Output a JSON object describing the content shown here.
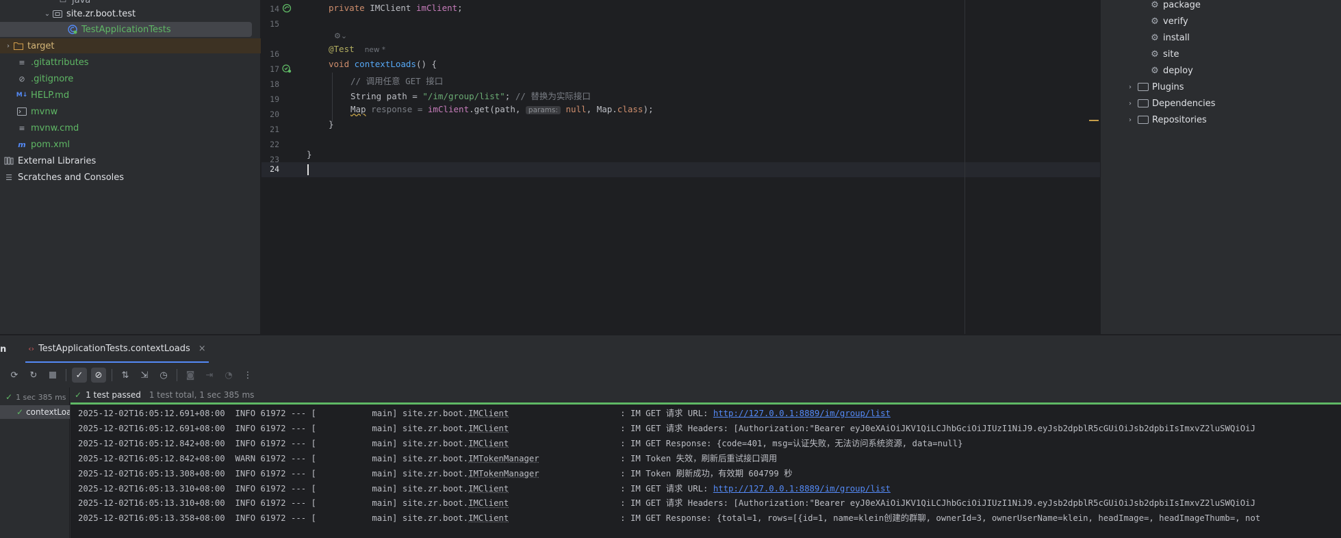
{
  "project_tree": {
    "items": [
      {
        "label": "java",
        "indent": 4
      },
      {
        "label": "site.zr.boot.test"
      },
      {
        "label": "TestApplicationTests"
      },
      {
        "label": "target"
      },
      {
        "label": ".gitattributes"
      },
      {
        "label": ".gitignore"
      },
      {
        "label": "HELP.md"
      },
      {
        "label": "mvnw"
      },
      {
        "label": "mvnw.cmd"
      },
      {
        "label": "pom.xml"
      },
      {
        "label": "External Libraries"
      },
      {
        "label": "Scratches and Consoles"
      }
    ]
  },
  "editor": {
    "line_numbers": [
      "14",
      "15",
      "16",
      "17",
      "18",
      "19",
      "20",
      "21",
      "22",
      "23",
      "24"
    ],
    "code": {
      "l14_kw": "private ",
      "l14_type": "IMClient ",
      "l14_field": "imClient",
      "l14_end": ";",
      "l16_ann": "@Test",
      "l16_hint": "new *",
      "l17_kw": "void ",
      "l17_fn": "contextLoads",
      "l17_end": "() {",
      "l18_cmt": "// 调用任意 GET 接口",
      "l19_type": "String path = ",
      "l19_str": "\"/im/group/list\"",
      "l19_semi": "; ",
      "l19_cmt": "// 替换为实际接口",
      "l20_type": "Map",
      "l20_var": " response = ",
      "l20_field": "imClient",
      "l20_call": ".get(path, ",
      "l20_hint": "params:",
      "l20_null": " null",
      "l20_rest": ", Map.",
      "l20_class": "class",
      "l20_end": ");",
      "l21": "}",
      "l23": "}"
    }
  },
  "maven": {
    "lifecycle": [
      "package",
      "verify",
      "install",
      "site",
      "deploy"
    ],
    "groups": [
      "Plugins",
      "Dependencies",
      "Repositories"
    ]
  },
  "run": {
    "panel_label": "n",
    "tab_label": "TestApplicationTests.contextLoads",
    "tree_time": "1 sec 385 ms",
    "tree_item": "contextLoa",
    "status_passed": "1 test passed",
    "status_detail": "1 test total, 1 sec 385 ms",
    "logs": [
      {
        "ts": "2025-12-02T16:05:12.691+08:00",
        "level": "INFO",
        "pid": "61972",
        "thread": "main",
        "logger_pkg": "site.zr.boot.",
        "logger_cls": "IMClient",
        "msg": ": IM GET 请求 URL: ",
        "link": "http://127.0.0.1:8889/im/group/list",
        "tail": ""
      },
      {
        "ts": "2025-12-02T16:05:12.691+08:00",
        "level": "INFO",
        "pid": "61972",
        "thread": "main",
        "logger_pkg": "site.zr.boot.",
        "logger_cls": "IMClient",
        "msg": ": IM GET 请求 Headers: [Authorization:\"Bearer eyJ0eXAiOiJKV1QiLCJhbGciOiJIUzI1NiJ9.eyJsb2dpblR5cGUiOiJsb2dpbiIsImxvZ2luSWQiOiJ",
        "link": "",
        "tail": ""
      },
      {
        "ts": "2025-12-02T16:05:12.842+08:00",
        "level": "INFO",
        "pid": "61972",
        "thread": "main",
        "logger_pkg": "site.zr.boot.",
        "logger_cls": "IMClient",
        "msg": ": IM GET Response: {code=401, msg=认证失败，无法访问系统资源, data=null}",
        "link": "",
        "tail": ""
      },
      {
        "ts": "2025-12-02T16:05:12.842+08:00",
        "level": "WARN",
        "pid": "61972",
        "thread": "main",
        "logger_pkg": "site.zr.boot.",
        "logger_cls": "IMTokenManager",
        "msg": ": IM Token 失效，刷新后重试接口调用",
        "link": "",
        "tail": ""
      },
      {
        "ts": "2025-12-02T16:05:13.308+08:00",
        "level": "INFO",
        "pid": "61972",
        "thread": "main",
        "logger_pkg": "site.zr.boot.",
        "logger_cls": "IMTokenManager",
        "msg": ": IM Token 刷新成功，有效期 604799 秒",
        "link": "",
        "tail": ""
      },
      {
        "ts": "2025-12-02T16:05:13.310+08:00",
        "level": "INFO",
        "pid": "61972",
        "thread": "main",
        "logger_pkg": "site.zr.boot.",
        "logger_cls": "IMClient",
        "msg": ": IM GET 请求 URL: ",
        "link": "http://127.0.0.1:8889/im/group/list",
        "tail": ""
      },
      {
        "ts": "2025-12-02T16:05:13.310+08:00",
        "level": "INFO",
        "pid": "61972",
        "thread": "main",
        "logger_pkg": "site.zr.boot.",
        "logger_cls": "IMClient",
        "msg": ": IM GET 请求 Headers: [Authorization:\"Bearer eyJ0eXAiOiJKV1QiLCJhbGciOiJIUzI1NiJ9.eyJsb2dpblR5cGUiOiJsb2dpbiIsImxvZ2luSWQiOiJ",
        "link": "",
        "tail": ""
      },
      {
        "ts": "2025-12-02T16:05:13.358+08:00",
        "level": "INFO",
        "pid": "61972",
        "thread": "main",
        "logger_pkg": "site.zr.boot.",
        "logger_cls": "IMClient",
        "msg": ": IM GET Response: {total=1, rows=[{id=1, name=klein创建的群聊, ownerId=3, ownerUserName=klein, headImage=, headImageThumb=, not",
        "link": "",
        "tail": ""
      }
    ]
  },
  "colors": {
    "accent_green": "#5fb865",
    "link_blue": "#548af7",
    "keyword": "#cf8e6d",
    "function": "#56a8f5",
    "field": "#c77dbb",
    "string": "#6aab73",
    "annotation": "#b3ae60"
  }
}
